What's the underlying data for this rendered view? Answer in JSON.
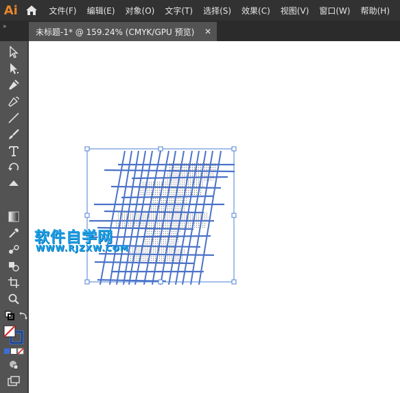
{
  "app": {
    "logo": "Ai"
  },
  "menu": {
    "items": [
      {
        "label": "文件(F)"
      },
      {
        "label": "编辑(E)"
      },
      {
        "label": "对象(O)"
      },
      {
        "label": "文字(T)"
      },
      {
        "label": "选择(S)"
      },
      {
        "label": "效果(C)"
      },
      {
        "label": "视图(V)"
      },
      {
        "label": "窗口(W)"
      },
      {
        "label": "帮助(H)"
      }
    ]
  },
  "tabbar": {
    "collapse_glyph": "»"
  },
  "document": {
    "tab_title": "未标题-1* @ 159.24% (CMYK/GPU 预览)",
    "close_glyph": "✕"
  },
  "toolbar": {
    "tools": [
      {
        "name": "selection-tool",
        "icon": "arrow-icon"
      },
      {
        "name": "direct-selection-tool",
        "icon": "white-arrow-icon"
      },
      {
        "name": "pen-tool",
        "icon": "pen-icon"
      },
      {
        "name": "curvature-tool",
        "icon": "curvature-pen-icon"
      },
      {
        "name": "line-segment-tool",
        "icon": "line-icon"
      },
      {
        "name": "paintbrush-tool",
        "icon": "brush-icon"
      },
      {
        "name": "type-tool",
        "icon": "type-icon"
      },
      {
        "name": "rotate-tool",
        "icon": "rotate-icon"
      },
      {
        "name": "eraser-tool",
        "icon": "eraser-icon"
      },
      {
        "name": "gradient-tool",
        "icon": "gradient-icon"
      },
      {
        "name": "eyedropper-tool",
        "icon": "eyedropper-icon"
      },
      {
        "name": "blend-tool",
        "icon": "blend-icon"
      },
      {
        "name": "shape-builder-tool",
        "icon": "shape-builder-icon"
      },
      {
        "name": "artboard-tool",
        "icon": "artboard-icon"
      },
      {
        "name": "zoom-tool",
        "icon": "magnifier-icon"
      }
    ],
    "fill_color": "#ffffff",
    "stroke_color": "#3a6fd8"
  },
  "watermark": {
    "title": "软件自学网",
    "subtitle": "WWW.RJZXW.COM",
    "color": "#1aa0e8"
  },
  "artwork": {
    "stroke_color": "#4a72c8",
    "selection_color": "#4a7fd4",
    "halftone_color": "#8a8a8a"
  }
}
